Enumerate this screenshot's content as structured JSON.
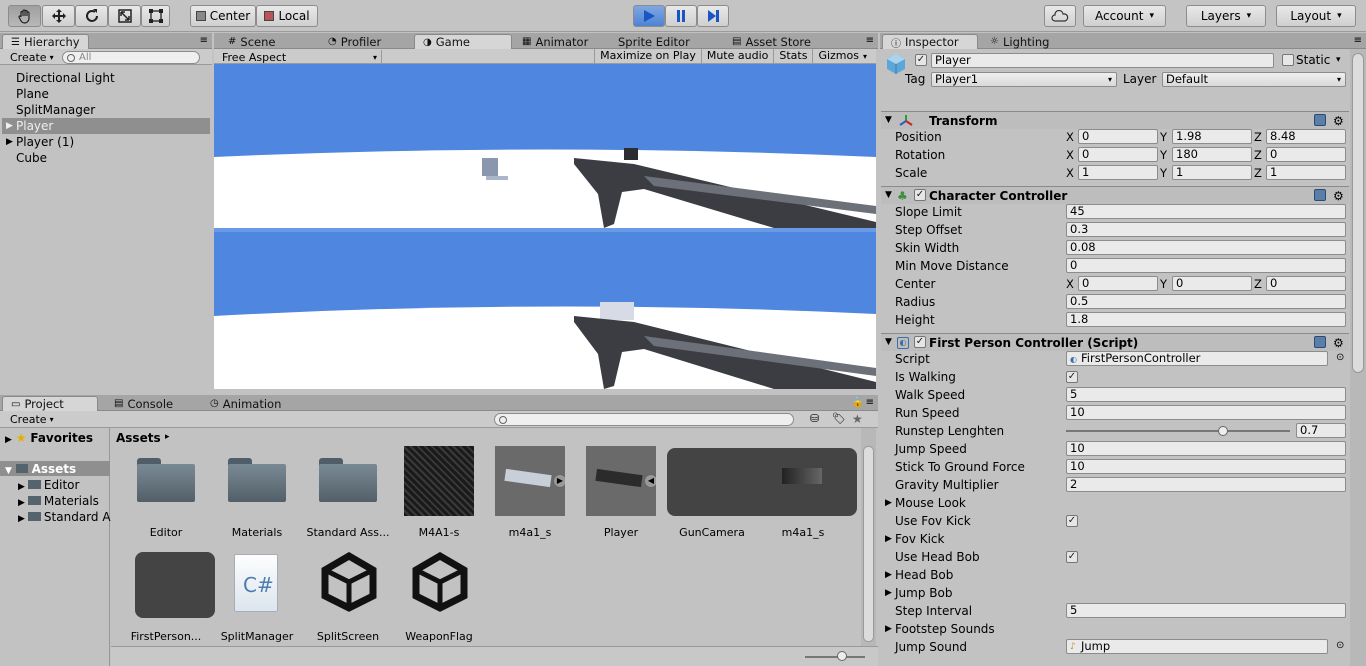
{
  "toolbar": {
    "tools": [
      "hand-tool-icon",
      "move-tool-icon",
      "rotate-tool-icon",
      "scale-tool-icon",
      "rect-tool-icon"
    ],
    "pivot": "Center",
    "space": "Local",
    "account": "Account",
    "layers": "Layers",
    "layout": "Layout"
  },
  "hierarchy": {
    "tab": "Hierarchy",
    "create": "Create",
    "search_placeholder": "All",
    "items": [
      {
        "label": "Directional Light",
        "expandable": false,
        "selected": false
      },
      {
        "label": "Plane",
        "expandable": false,
        "selected": false
      },
      {
        "label": "SplitManager",
        "expandable": false,
        "selected": false
      },
      {
        "label": "Player",
        "expandable": true,
        "selected": true
      },
      {
        "label": "Player (1)",
        "expandable": true,
        "selected": false
      },
      {
        "label": "Cube",
        "expandable": false,
        "selected": false
      }
    ]
  },
  "center_tabs": [
    "Scene",
    "Profiler",
    "Game",
    "Animator",
    "Sprite Editor",
    "Asset Store"
  ],
  "game": {
    "aspect": "Free Aspect",
    "options": [
      "Maximize on Play",
      "Mute audio",
      "Stats",
      "Gizmos"
    ],
    "sky_color": "#4e86e0",
    "ground_color": "#ffffff"
  },
  "project": {
    "tabs": [
      "Project",
      "Console",
      "Animation"
    ],
    "create": "Create",
    "favorites": "Favorites",
    "assets_root": "Assets",
    "folders": [
      "Editor",
      "Materials",
      "Standard A"
    ],
    "breadcrumb": "Assets",
    "assets_row1": [
      "Editor",
      "Materials",
      "Standard Ass...",
      "M4A1-s",
      "m4a1_s",
      "Player",
      "GunCamera",
      "m4a1_s"
    ],
    "assets_row2": [
      "FirstPerson...",
      "SplitManager",
      "SplitScreen",
      "WeaponFlag"
    ],
    "cs_label": "C#"
  },
  "inspector": {
    "tabs": [
      "Inspector",
      "Lighting"
    ],
    "name": "Player",
    "static_label": "Static",
    "tag_label": "Tag",
    "tag_value": "Player1",
    "layer_label": "Layer",
    "layer_value": "Default",
    "transform": {
      "title": "Transform",
      "position": {
        "label": "Position",
        "x": "0",
        "y": "1.98",
        "z": "8.48"
      },
      "rotation": {
        "label": "Rotation",
        "x": "0",
        "y": "180",
        "z": "0"
      },
      "scale": {
        "label": "Scale",
        "x": "1",
        "y": "1",
        "z": "1"
      }
    },
    "character_controller": {
      "title": "Character Controller",
      "slope_limit": {
        "label": "Slope Limit",
        "value": "45"
      },
      "step_offset": {
        "label": "Step Offset",
        "value": "0.3"
      },
      "skin_width": {
        "label": "Skin Width",
        "value": "0.08"
      },
      "min_move": {
        "label": "Min Move Distance",
        "value": "0"
      },
      "center": {
        "label": "Center",
        "x": "0",
        "y": "0",
        "z": "0"
      },
      "radius": {
        "label": "Radius",
        "value": "0.5"
      },
      "height": {
        "label": "Height",
        "value": "1.8"
      }
    },
    "fpc": {
      "title": "First Person Controller (Script)",
      "script": {
        "label": "Script",
        "value": "FirstPersonController"
      },
      "is_walking": {
        "label": "Is Walking",
        "checked": true
      },
      "walk_speed": {
        "label": "Walk Speed",
        "value": "5"
      },
      "run_speed": {
        "label": "Run Speed",
        "value": "10"
      },
      "runstep": {
        "label": "Runstep Lenghten",
        "value": "0.7",
        "fraction": 0.7
      },
      "jump_speed": {
        "label": "Jump Speed",
        "value": "10"
      },
      "stick": {
        "label": "Stick To Ground Force",
        "value": "10"
      },
      "gravity": {
        "label": "Gravity Multiplier",
        "value": "2"
      },
      "mouse_look": {
        "label": "Mouse Look"
      },
      "use_fov": {
        "label": "Use Fov Kick",
        "checked": true
      },
      "fov_kick": {
        "label": "Fov Kick"
      },
      "use_head_bob": {
        "label": "Use Head Bob",
        "checked": true
      },
      "head_bob": {
        "label": "Head Bob"
      },
      "jump_bob": {
        "label": "Jump Bob"
      },
      "step_interval": {
        "label": "Step Interval",
        "value": "5"
      },
      "footstep": {
        "label": "Footstep Sounds"
      },
      "jump_sound": {
        "label": "Jump Sound",
        "value": "Jump"
      }
    }
  }
}
